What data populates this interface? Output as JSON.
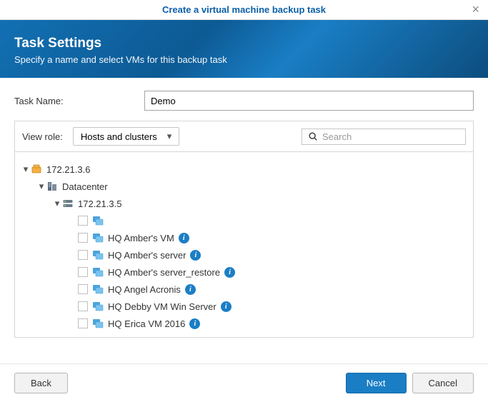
{
  "window": {
    "title": "Create a virtual machine backup task"
  },
  "header": {
    "title": "Task Settings",
    "subtitle": "Specify a name and select VMs for this backup task"
  },
  "form": {
    "task_name_label": "Task Name:",
    "task_name_value": "Demo"
  },
  "filter": {
    "view_role_label": "View role:",
    "view_role_value": "Hosts and clusters",
    "search_placeholder": "Search"
  },
  "tree": {
    "root": {
      "label": "172.21.3.6"
    },
    "datacenter": {
      "label": "Datacenter"
    },
    "host": {
      "label": "172.21.3.5"
    },
    "vms": [
      {
        "label": "",
        "info": false
      },
      {
        "label": "HQ Amber's VM",
        "info": true
      },
      {
        "label": "HQ Amber's server",
        "info": true
      },
      {
        "label": "HQ Amber's server_restore",
        "info": true
      },
      {
        "label": "HQ Angel Acronis",
        "info": true
      },
      {
        "label": "HQ Debby VM Win Server",
        "info": true
      },
      {
        "label": "HQ Erica VM 2016",
        "info": true
      }
    ]
  },
  "buttons": {
    "back": "Back",
    "next": "Next",
    "cancel": "Cancel"
  }
}
